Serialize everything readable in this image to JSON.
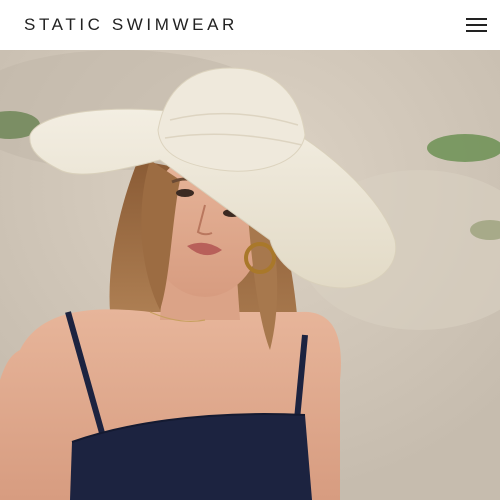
{
  "header": {
    "brand": "STATIC SWIMWEAR",
    "menu_icon": "hamburger-menu-icon"
  },
  "hero": {
    "image_subject": "model-in-straw-hat-photo"
  },
  "colors": {
    "header_bg": "#ffffff",
    "brand_text": "#222222",
    "swimsuit": "#1c2340",
    "hat": "#ece6d6"
  }
}
